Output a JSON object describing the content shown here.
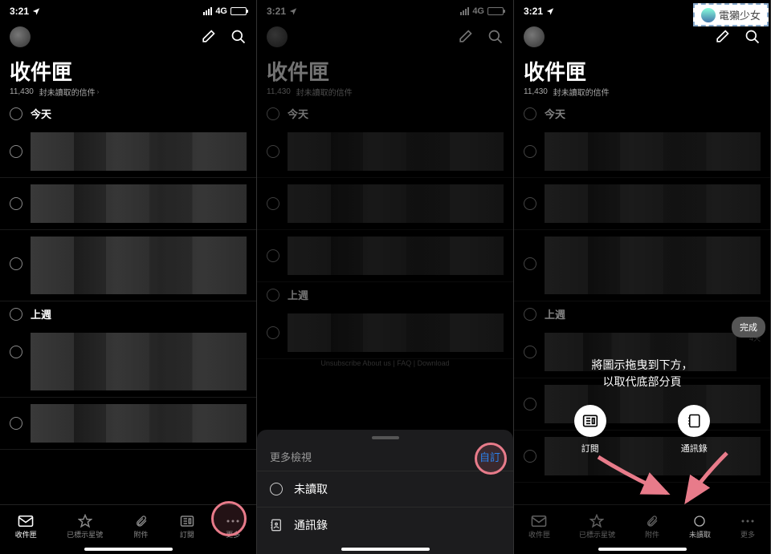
{
  "status": {
    "time": "3:21",
    "network": "4G"
  },
  "inbox": {
    "title": "收件匣",
    "unread_count": "11,430",
    "unread_label": "封未讀取的信件",
    "sections": {
      "today": "今天",
      "last_week": "上週"
    }
  },
  "tabs": {
    "inbox": "收件匣",
    "starred": "已標示星號",
    "attachments": "附件",
    "subscriptions": "訂閱",
    "more": "更多",
    "unread": "未讀取"
  },
  "sheet": {
    "title": "更多檢視",
    "customize": "自訂",
    "rows": {
      "unread": "未讀取",
      "contacts": "通訊錄"
    }
  },
  "customize": {
    "done": "完成",
    "instruction_line1": "將圖示拖曳到下方，",
    "instruction_line2": "以取代底部分頁",
    "items": {
      "subscriptions": "訂閱",
      "contacts": "通訊錄"
    }
  },
  "footer_snippet": "Unsubscribe About us | FAQ | Download",
  "s3_time_labels": {
    "days4": "4天"
  },
  "watermark": "電獺少女"
}
